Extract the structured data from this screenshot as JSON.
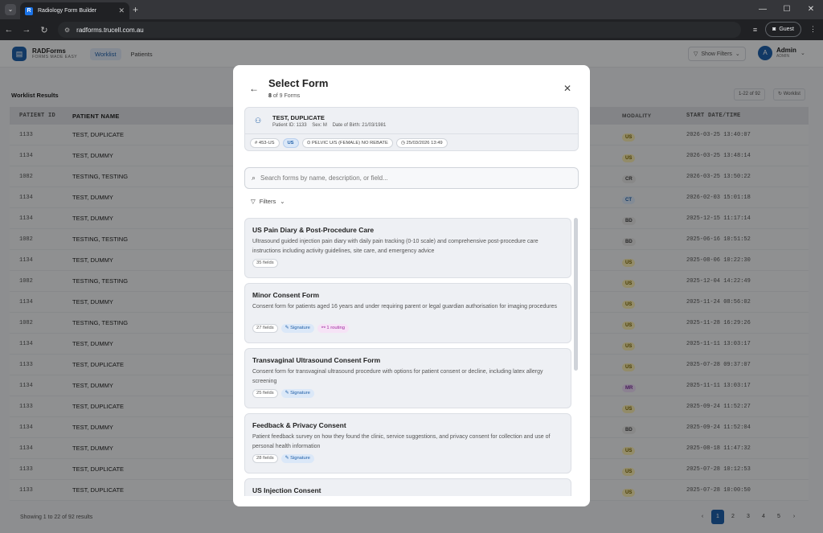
{
  "browser": {
    "tab_title": "Radiology Form Builder",
    "url": "radforms.trucell.com.au",
    "profile": "Guest"
  },
  "app": {
    "brand": "RADForms",
    "tagline": "FORMS MADE EASY",
    "nav": [
      "Worklist",
      "Patients"
    ],
    "show_filters": "Show Filters",
    "avatar_initial": "A",
    "user_name": "Admin",
    "user_role": "ADMIN"
  },
  "worklist": {
    "title": "Worklist Results",
    "page_count": "1-22 of 92",
    "worklist_button": "Worklist",
    "columns": [
      "PATIENT ID",
      "PATIENT NAME",
      "MODALITY",
      "START DATE/TIME"
    ],
    "rows": [
      {
        "id": "1133",
        "name": "TEST, DUPLICATE",
        "modality": "US",
        "date": "2026-03-25 13:40:07"
      },
      {
        "id": "1134",
        "name": "TEST, DUMMY",
        "modality": "US",
        "date": "2026-03-25 13:48:14"
      },
      {
        "id": "1082",
        "name": "TESTING, TESTING",
        "modality": "CR",
        "date": "2026-03-25 13:50:22"
      },
      {
        "id": "1134",
        "name": "TEST, DUMMY",
        "modality": "CT",
        "date": "2026-02-03 15:01:18"
      },
      {
        "id": "1134",
        "name": "TEST, DUMMY",
        "modality": "BD",
        "date": "2025-12-15 11:17:14"
      },
      {
        "id": "1082",
        "name": "TESTING, TESTING",
        "modality": "BD",
        "date": "2025-06-16 10:51:52"
      },
      {
        "id": "1134",
        "name": "TEST, DUMMY",
        "modality": "US",
        "date": "2025-08-06 10:22:30"
      },
      {
        "id": "1082",
        "name": "TESTING, TESTING",
        "modality": "US",
        "date": "2025-12-04 14:22:49"
      },
      {
        "id": "1134",
        "name": "TEST, DUMMY",
        "modality": "US",
        "date": "2025-11-24 08:56:02"
      },
      {
        "id": "1082",
        "name": "TESTING, TESTING",
        "modality": "US",
        "date": "2025-11-28 16:29:26"
      },
      {
        "id": "1134",
        "name": "TEST, DUMMY",
        "modality": "US",
        "date": "2025-11-11 13:03:17"
      },
      {
        "id": "1133",
        "name": "TEST, DUPLICATE",
        "modality": "US",
        "date": "2025-07-28 09:37:07"
      },
      {
        "id": "1134",
        "name": "TEST, DUMMY",
        "modality": "MR",
        "date": "2025-11-11 13:03:17"
      },
      {
        "id": "1133",
        "name": "TEST, DUPLICATE",
        "modality": "US",
        "date": "2025-09-24 11:52:27"
      },
      {
        "id": "1134",
        "name": "TEST, DUMMY",
        "modality": "BD",
        "date": "2025-09-24 11:52:04"
      },
      {
        "id": "1134",
        "name": "TEST, DUMMY",
        "modality": "US",
        "date": "2025-08-18 11:47:32"
      },
      {
        "id": "1133",
        "name": "TEST, DUPLICATE",
        "modality": "US",
        "date": "2025-07-28 10:12:53"
      },
      {
        "id": "1133",
        "name": "TEST, DUPLICATE",
        "modality": "US",
        "date": "2025-07-28 10:00:50"
      }
    ],
    "showing": "Showing 1 to 22 of 92 results",
    "pages": [
      "1",
      "2",
      "3",
      "4",
      "5"
    ]
  },
  "modal": {
    "title": "Select Form",
    "subtitle_count": "8",
    "subtitle_rest": " of 9 Forms",
    "patient": {
      "name": "TEST, DUPLICATE",
      "details": "Patient ID: 1133    Sex: M    Date of Birth: 21/03/1981",
      "chips": {
        "accession": "453-US",
        "modality": "US",
        "exam": "PELVIC U/S (FEMALE) NO REBATE",
        "datetime": "25/03/2026 13:49"
      }
    },
    "search_placeholder": "Search forms by name, description, or field...",
    "filters_label": "Filters",
    "forms": [
      {
        "title": "US Pain Diary & Post-Procedure Care",
        "desc": "Ultrasound guided injection pain diary with daily pain tracking (0-10 scale) and comprehensive post-procedure care instructions including activity guidelines, site care, and emergency advice",
        "fields": "35 fields"
      },
      {
        "title": "Minor Consent Form",
        "desc": "Consent form for patients aged 16 years and under requiring parent or legal guardian authorisation for imaging procedures",
        "fields": "27 fields",
        "signature": "Signature",
        "routing": "1 routing"
      },
      {
        "title": "Transvaginal Ultrasound Consent Form",
        "desc": "Consent form for transvaginal ultrasound procedure with options for patient consent or decline, including latex allergy screening",
        "fields": "25 fields",
        "signature": "Signature"
      },
      {
        "title": "Feedback & Privacy Consent",
        "desc": "Patient feedback survey on how they found the clinic, service suggestions, and privacy consent for collection and use of personal health information",
        "fields": "28 fields",
        "signature": "Signature"
      },
      {
        "title": "US Injection Consent"
      }
    ]
  }
}
